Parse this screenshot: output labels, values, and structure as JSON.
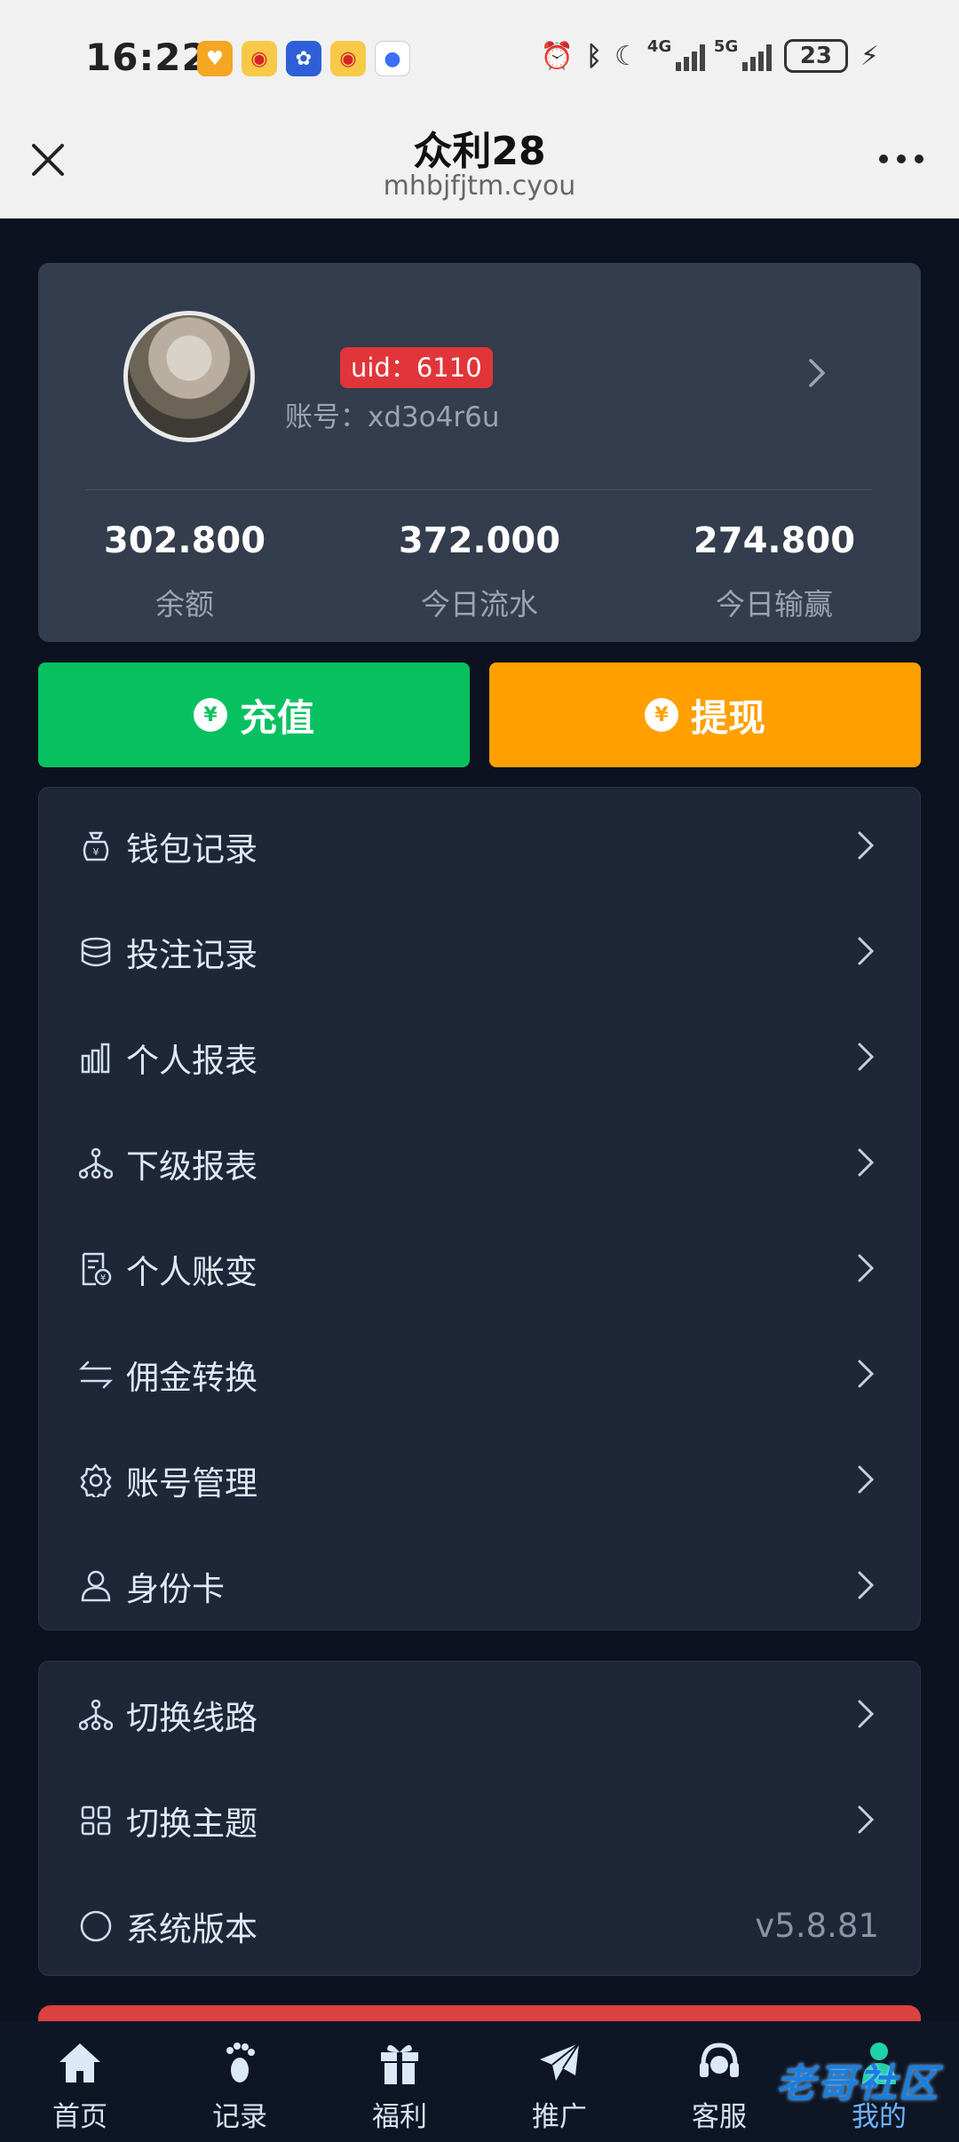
{
  "status_bar": {
    "time": "16:22",
    "battery": "23",
    "net1": "4G",
    "net2": "5G"
  },
  "title_bar": {
    "title": "众利28",
    "url": "mhbjfjtm.cyou"
  },
  "profile": {
    "uid_badge": "uid：6110",
    "account": "账号：xd3o4r6u",
    "stats": [
      {
        "value": "302.800",
        "label": "余额"
      },
      {
        "value": "372.000",
        "label": "今日流水"
      },
      {
        "value": "274.800",
        "label": "今日输赢"
      }
    ]
  },
  "actions": {
    "recharge": "充值",
    "withdraw": "提现",
    "recharge_color": "#07c160",
    "withdraw_color": "#ffa000"
  },
  "menu": [
    {
      "label": "钱包记录",
      "icon": "money-bag-icon"
    },
    {
      "label": "投注记录",
      "icon": "coins-stack-icon"
    },
    {
      "label": "个人报表",
      "icon": "bar-chart-icon"
    },
    {
      "label": "下级报表",
      "icon": "hierarchy-icon"
    },
    {
      "label": "个人账变",
      "icon": "bill-icon"
    },
    {
      "label": "佣金转换",
      "icon": "swap-icon"
    },
    {
      "label": "账号管理",
      "icon": "gear-icon"
    },
    {
      "label": "身份卡",
      "icon": "user-icon"
    }
  ],
  "menu2": [
    {
      "label": "切换线路",
      "icon": "hierarchy-icon"
    },
    {
      "label": "切换主题",
      "icon": "grid-icon"
    },
    {
      "label": "系统版本",
      "icon": "circle-icon",
      "value": "v5.8.81"
    }
  ],
  "bottom_nav": [
    {
      "label": "首页",
      "icon": "home-icon"
    },
    {
      "label": "记录",
      "icon": "footprint-icon"
    },
    {
      "label": "福利",
      "icon": "gift-icon"
    },
    {
      "label": "推广",
      "icon": "paper-plane-icon"
    },
    {
      "label": "客服",
      "icon": "headset-icon"
    },
    {
      "label": "我的",
      "icon": "person-icon"
    }
  ],
  "watermark": "老哥社区"
}
